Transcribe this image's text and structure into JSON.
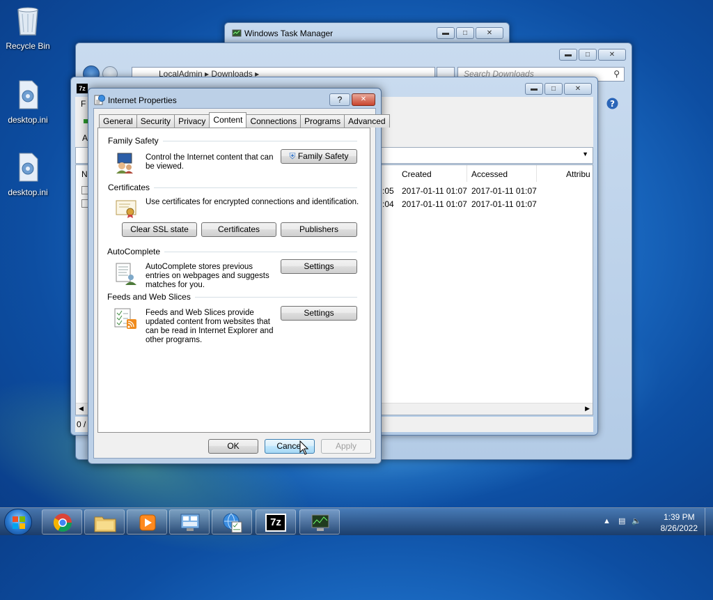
{
  "desktop": {
    "icons": [
      {
        "label": "Recycle Bin"
      },
      {
        "label": "desktop.ini"
      },
      {
        "label": "desktop.ini"
      }
    ]
  },
  "task_manager": {
    "title": "Windows Task Manager"
  },
  "explorer": {
    "breadcrumb": [
      "LocalAdmin",
      "Downloads"
    ],
    "search_placeholder": "Search Downloads"
  },
  "sevenzip": {
    "menu_first_letter": "F",
    "side_letters": [
      "A",
      "N"
    ],
    "columns": [
      "Created",
      "Accessed",
      "Attribu"
    ],
    "rows": [
      {
        "modified_tail": ":05",
        "created": "2017-01-11 01:07",
        "accessed": "2017-01-11 01:07"
      },
      {
        "modified_tail": ":04",
        "created": "2017-01-11 01:07",
        "accessed": "2017-01-11 01:07"
      }
    ],
    "status": "0 /"
  },
  "dialog": {
    "title": "Internet Properties",
    "help_symbol": "?",
    "tabs": [
      "General",
      "Security",
      "Privacy",
      "Content",
      "Connections",
      "Programs",
      "Advanced"
    ],
    "family_safety": {
      "title": "Family Safety",
      "desc": "Control the Internet content that can be viewed.",
      "button": "Family Safety"
    },
    "certificates": {
      "title": "Certificates",
      "desc": "Use certificates for encrypted connections and identification.",
      "buttons": [
        "Clear SSL state",
        "Certificates",
        "Publishers"
      ]
    },
    "autocomplete": {
      "title": "AutoComplete",
      "desc": "AutoComplete stores previous entries on webpages and suggests matches for you.",
      "button": "Settings"
    },
    "feeds": {
      "title": "Feeds and Web Slices",
      "desc": "Feeds and Web Slices provide updated content from websites that can be read in Internet Explorer and other programs.",
      "button": "Settings"
    },
    "footer": {
      "ok": "OK",
      "cancel": "Cancel",
      "apply": "Apply"
    }
  },
  "taskbar": {
    "apps": [
      "chrome-icon",
      "explorer-icon",
      "media-player-icon",
      "control-panel-icon",
      "internet-options-icon",
      "7zip-icon",
      "task-manager-icon"
    ],
    "sevenzip_label": "7z",
    "time": "1:39 PM",
    "date": "8/26/2022"
  }
}
